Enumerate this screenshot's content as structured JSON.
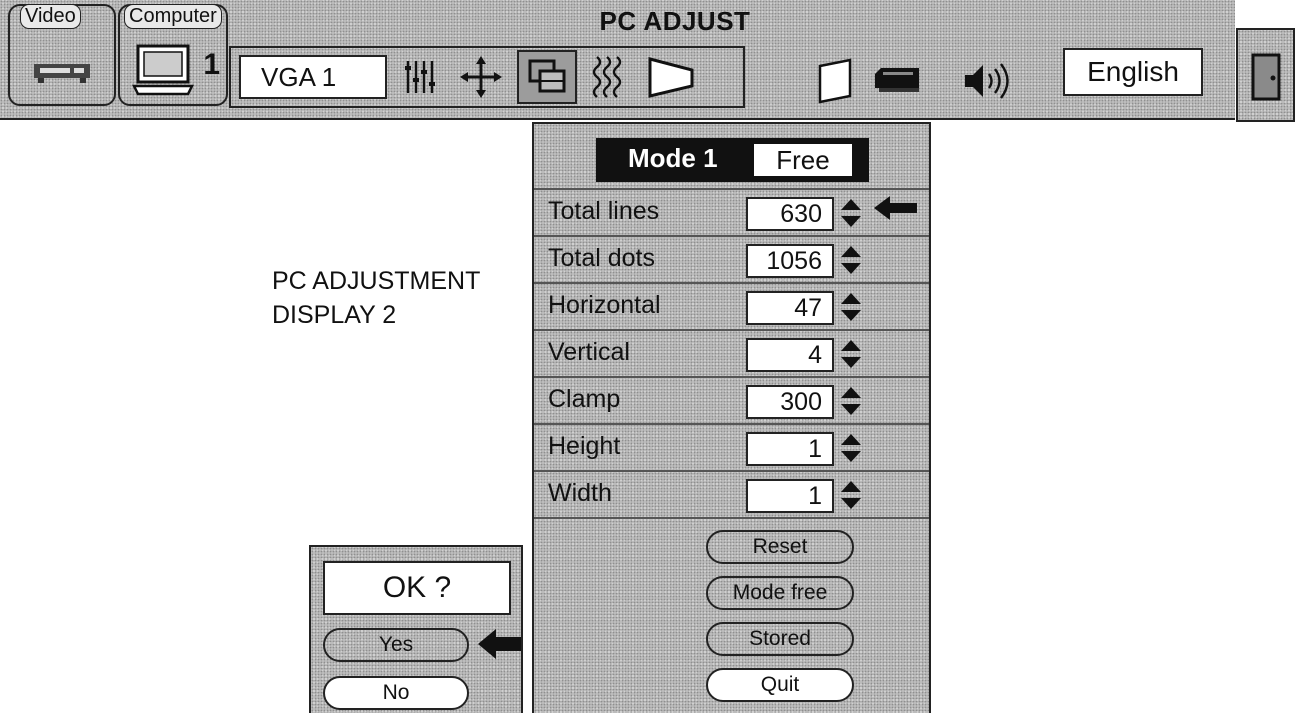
{
  "toolbar": {
    "title": "PC ADJUST",
    "video_label": "Video",
    "computer_label": "Computer",
    "computer_number": "1",
    "input_source": "VGA 1",
    "language": "English",
    "icons": [
      "video-deck-icon",
      "computer-monitor-icon",
      "image-adjust-icon",
      "position-icon",
      "pc-adjust-icon",
      "noise-icon",
      "keystone-icon",
      "screen-icon",
      "projector-icon",
      "volume-icon",
      "exit-icon"
    ]
  },
  "caption": {
    "line1": "PC ADJUSTMENT",
    "line2": "DISPLAY 2"
  },
  "panel": {
    "mode_label": "Mode 1",
    "mode_value": "Free",
    "rows": [
      {
        "label": "Total lines",
        "value": "630"
      },
      {
        "label": "Total dots",
        "value": "1056"
      },
      {
        "label": "Horizontal",
        "value": "47"
      },
      {
        "label": "Vertical",
        "value": "4"
      },
      {
        "label": "Clamp",
        "value": "300"
      },
      {
        "label": "Height",
        "value": "1"
      },
      {
        "label": "Width",
        "value": "1"
      }
    ],
    "buttons": [
      "Reset",
      "Mode free",
      "Stored",
      "Quit"
    ]
  },
  "dialog": {
    "prompt": "OK ?",
    "yes": "Yes",
    "no": "No"
  }
}
